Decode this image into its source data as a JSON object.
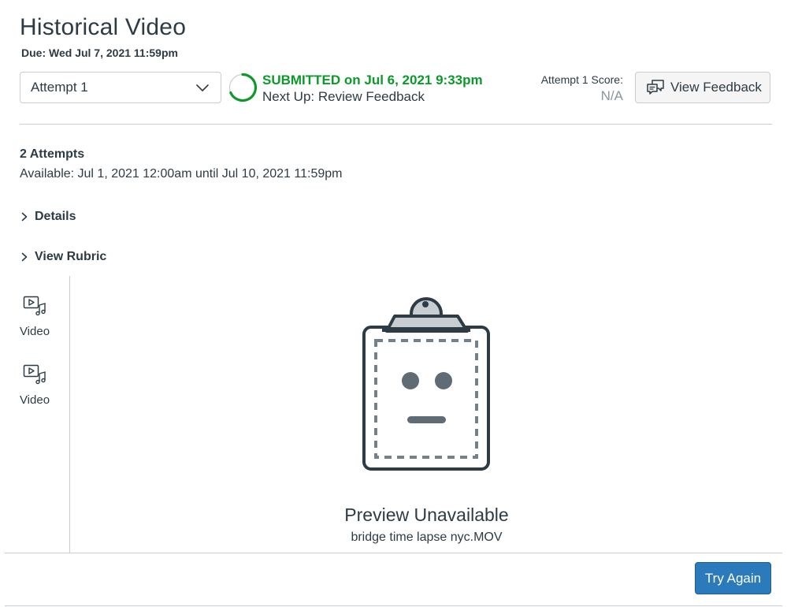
{
  "assignment": {
    "title": "Historical Video",
    "due": "Due: Wed Jul 7, 2021 11:59pm"
  },
  "attempt_select": {
    "value": "Attempt 1",
    "icon": "chevron-down-icon"
  },
  "status": {
    "submitted": "SUBMITTED on Jul 6, 2021 9:33pm",
    "next_up": "Next Up: Review Feedback",
    "color": "#0b9a2a"
  },
  "score": {
    "label": "Attempt 1 Score:",
    "value": "N/A"
  },
  "feedback_button": {
    "label": "View Feedback",
    "icon": "chat-bubbles-icon"
  },
  "details": {
    "attempts": "2 Attempts",
    "availability": "Available: Jul 1, 2021 12:00am until Jul 10, 2021 11:59pm"
  },
  "toggles": {
    "details": "Details",
    "rubric": "View Rubric"
  },
  "files": [
    {
      "label": "Video",
      "icon": "video-audio-icon"
    },
    {
      "label": "Video",
      "icon": "video-audio-icon"
    }
  ],
  "preview": {
    "title": "Preview Unavailable",
    "filename": "bridge time lapse nyc.MOV",
    "icon": "clipboard-face-icon"
  },
  "footer": {
    "try_again": "Try Again"
  },
  "colors": {
    "primary": "#2b7abc",
    "success": "#0b9a2a",
    "text": "#2d3b45",
    "muted": "#8b969e",
    "border": "#c7cdd1"
  }
}
